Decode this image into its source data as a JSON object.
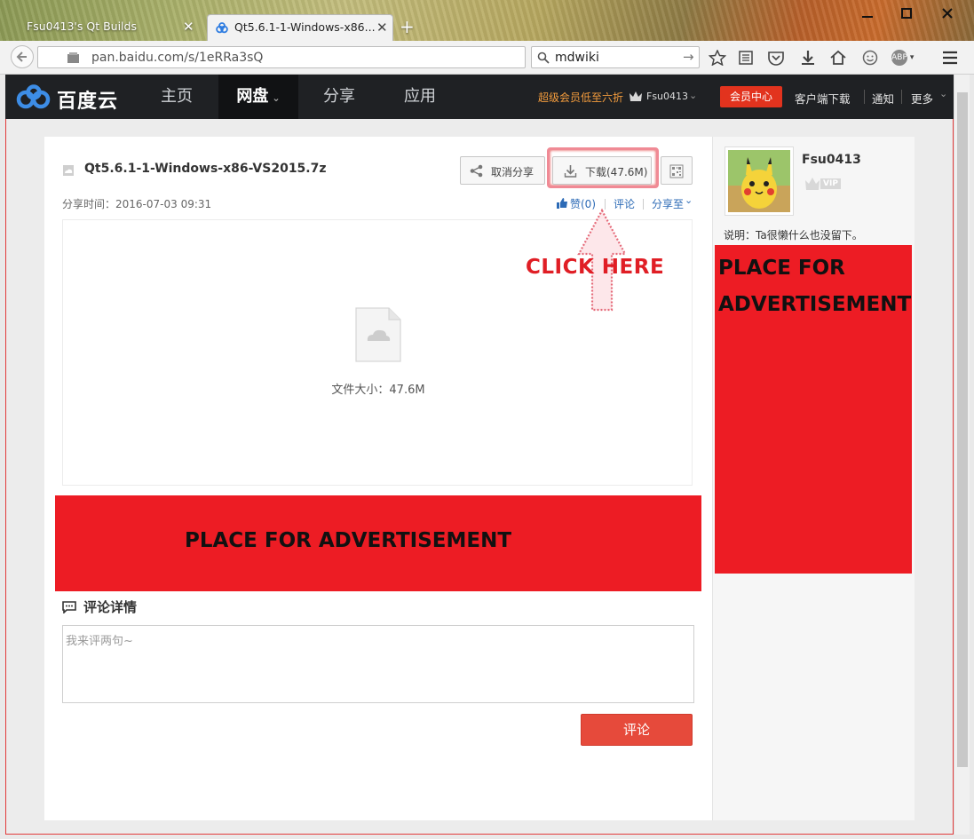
{
  "browser": {
    "tabs": [
      {
        "title": "Fsu0413's Qt Builds",
        "active": false
      },
      {
        "title": "Qt5.6.1-1-Windows-x86...",
        "active": true
      }
    ],
    "new_tab_label": "+",
    "url": "pan.baidu.com/s/1eRRa3sQ",
    "search_value": "mdwiki",
    "addon_label": "ABP"
  },
  "header": {
    "logo_text": "百度云",
    "nav": [
      {
        "label": "主页",
        "active": false
      },
      {
        "label": "网盘",
        "active": true
      },
      {
        "label": "分享",
        "active": false
      },
      {
        "label": "应用",
        "active": false
      }
    ],
    "promo": "超级会员低至六折",
    "user": "Fsu0413",
    "vip_center": "会员中心",
    "links": [
      "客户端下载",
      "通知",
      "更多"
    ]
  },
  "file": {
    "name": "Qt5.6.1-1-Windows-x86-VS2015.7z",
    "share_time_label": "分享时间：",
    "share_time": "2016-07-03 09:31",
    "cancel_share": "取消分享",
    "download": "下载(47.6M)",
    "like": "赞(0)",
    "comment": "评论",
    "share_to": "分享至",
    "size_text": "文件大小：47.6M"
  },
  "annotations": {
    "click_here": "CLICK HERE",
    "ad_banner": "PLACE FOR ADVERTISEMENT",
    "ad_sidebar": "PLACE FOR ADVERTISEMENT"
  },
  "comments": {
    "title": "评论详情",
    "placeholder": "我来评两句~",
    "submit": "评论"
  },
  "sidebar": {
    "username": "Fsu0413",
    "vip_label": "VIP",
    "description": "说明：Ta很懒什么也没留下。"
  },
  "colors": {
    "nav_bg": "#1f2124",
    "accent_red": "#e2331e",
    "ad_red": "#ed1c24",
    "link_blue": "#2d6bb6"
  }
}
